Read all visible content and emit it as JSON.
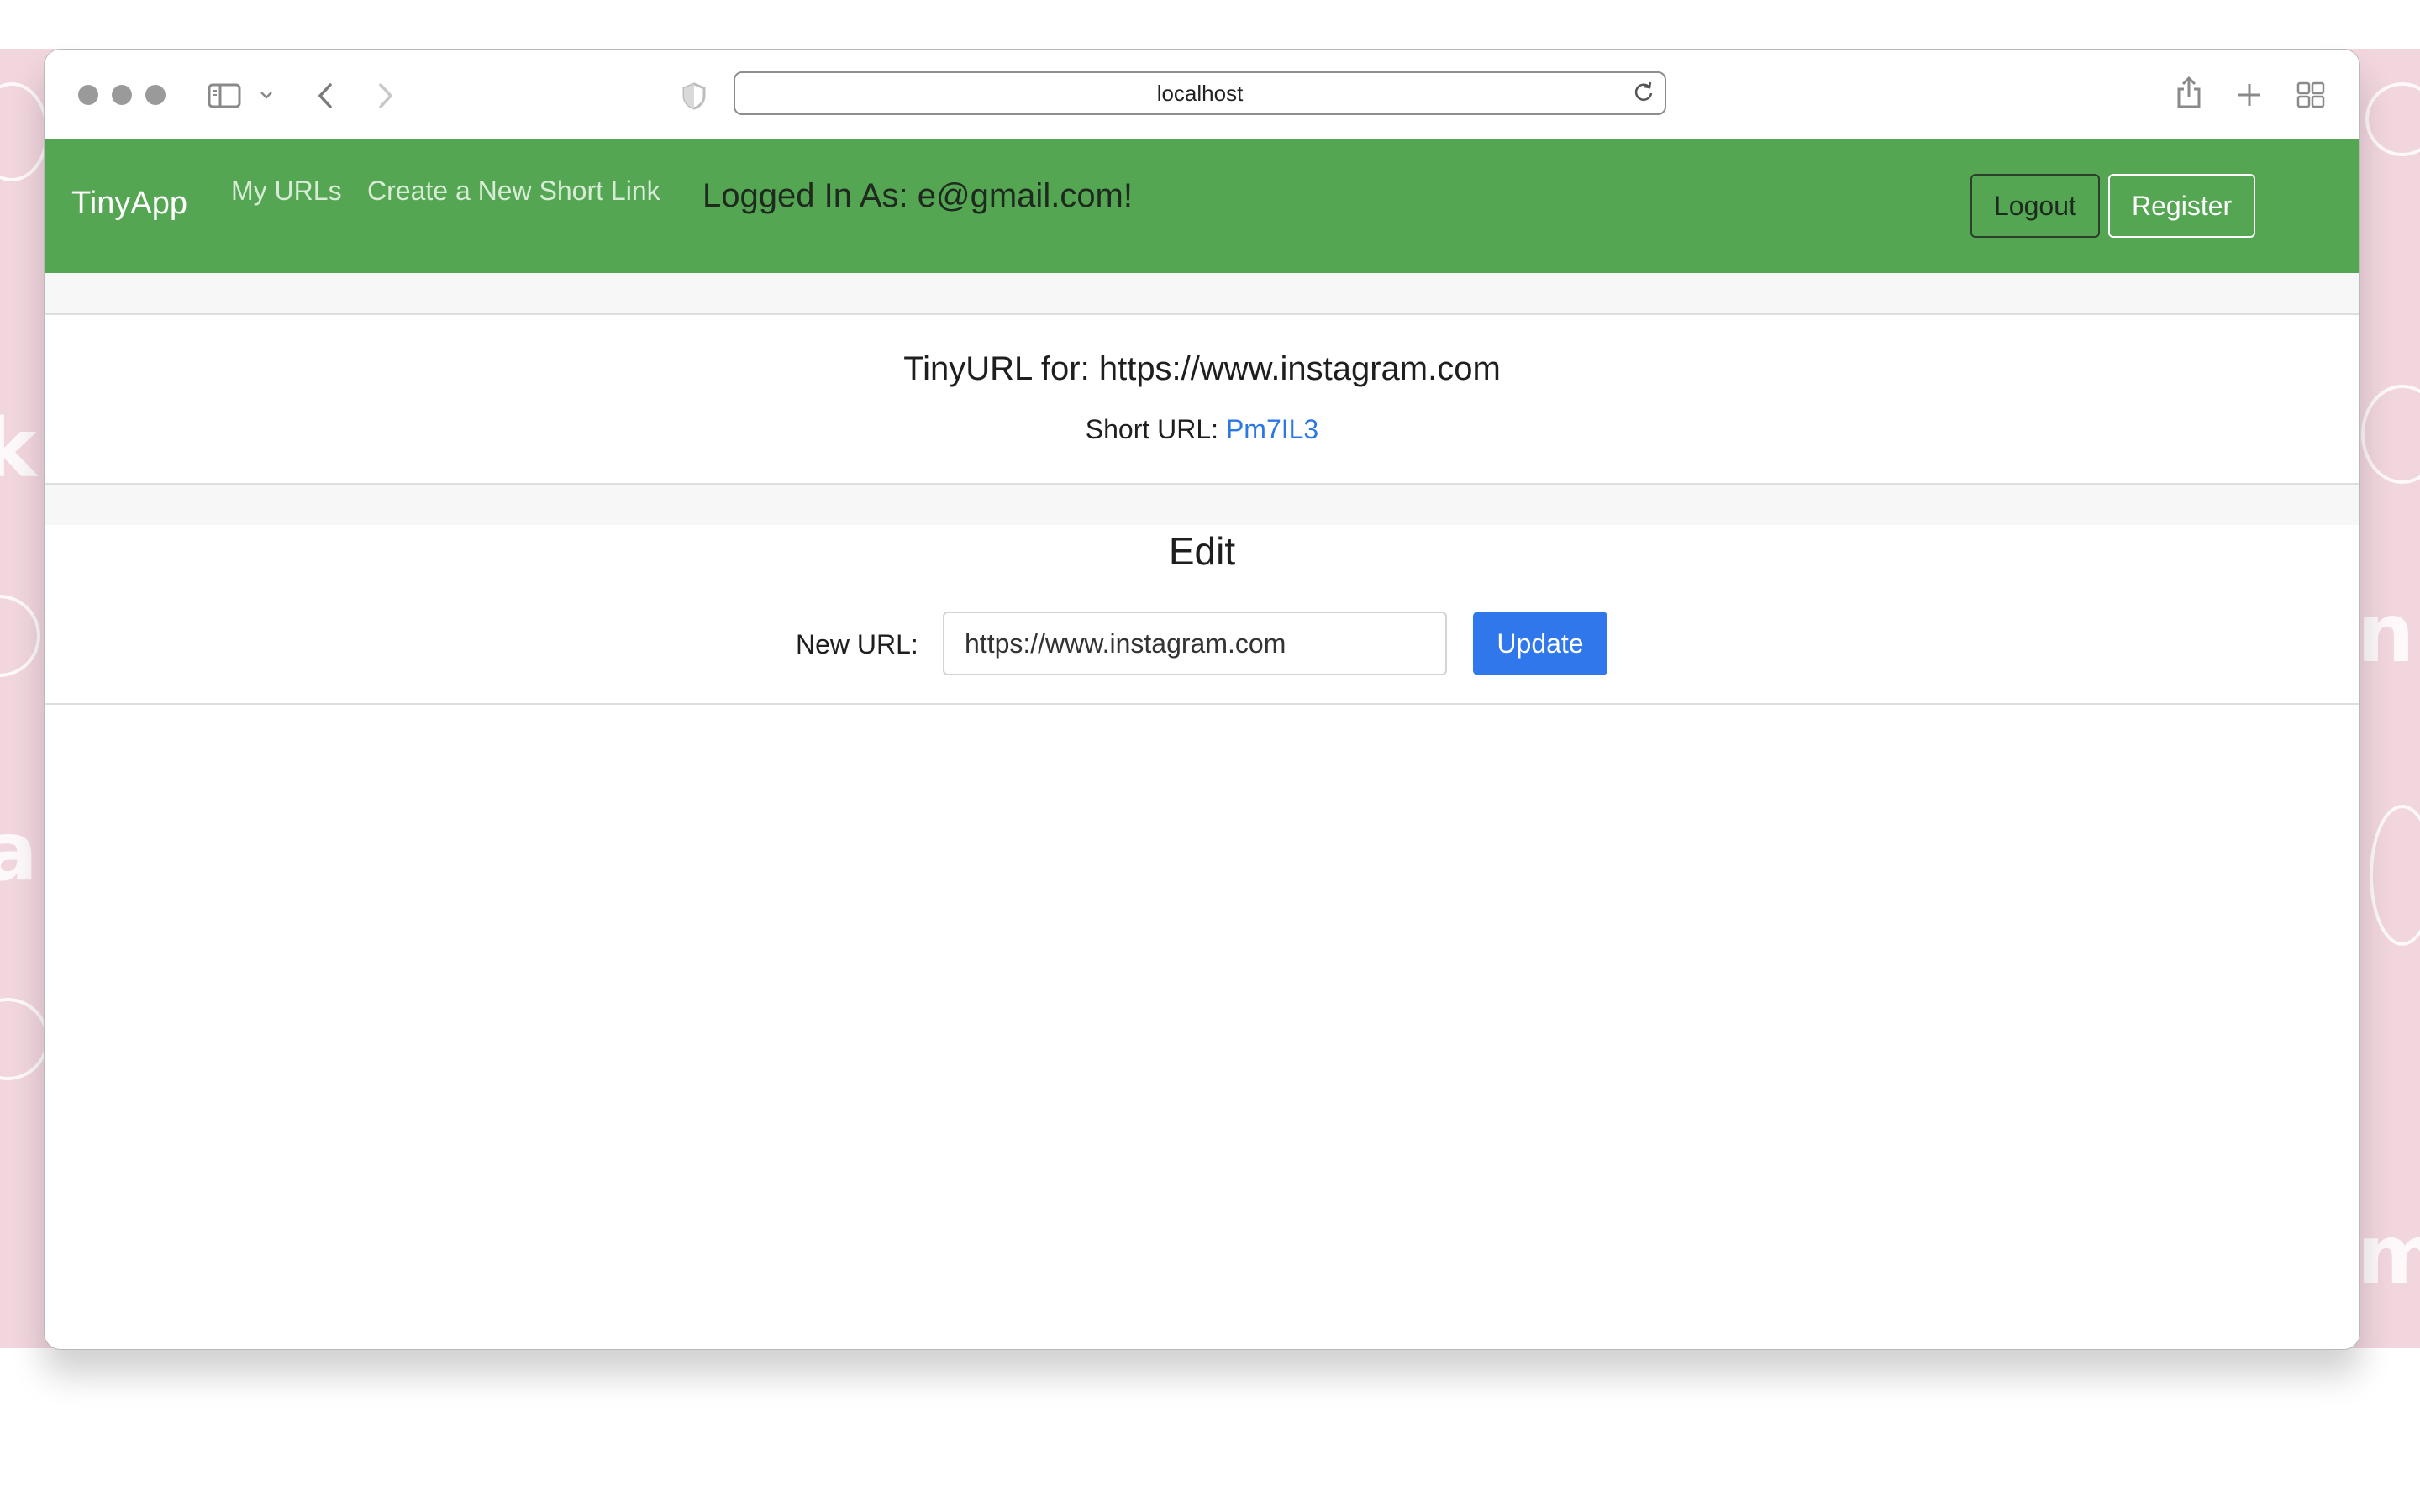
{
  "browser": {
    "address": "localhost"
  },
  "navbar": {
    "brand": "TinyApp",
    "links": [
      "My URLs",
      "Create a New Short Link"
    ],
    "logged_in": "Logged In As: e@gmail.com!",
    "logout_label": "Logout",
    "register_label": "Register",
    "color": "#54a653"
  },
  "url_card": {
    "title": "TinyURL for: https://www.instagram.com",
    "short_label": "Short URL:",
    "short_code": "Pm7IL3"
  },
  "edit": {
    "title": "Edit",
    "field_label": "New URL:",
    "field_value": "https://www.instagram.com",
    "update_label": "Update",
    "button_color": "#3077eb"
  },
  "icons": [
    "sidebar-icon",
    "chevron-down-icon",
    "back-icon",
    "forward-icon",
    "shield-icon",
    "reload-icon",
    "share-icon",
    "new-tab-icon",
    "tab-overview-icon"
  ]
}
